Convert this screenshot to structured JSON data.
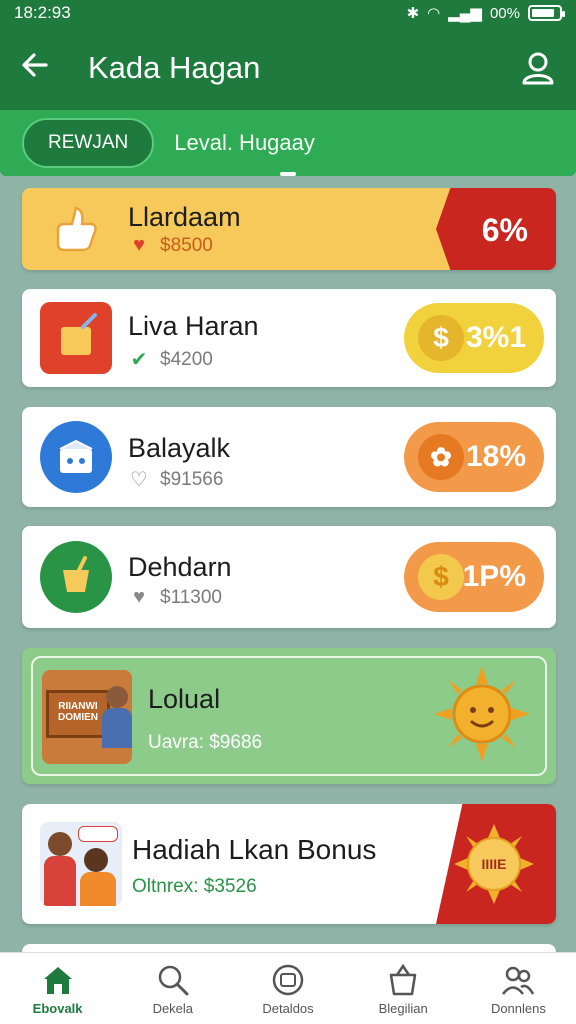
{
  "status_bar": {
    "time": "18:2:93",
    "icons": [
      "bluetooth-icon",
      "wifi-icon",
      "signal-icon"
    ],
    "battery_text": "00%",
    "battery_level": 0.85
  },
  "header": {
    "back_icon": "back-arrow-icon",
    "title": "Kada Hagan",
    "profile_icon": "user-icon"
  },
  "tabs": {
    "active_label": "REWJAN",
    "second_label": "Leval. Hugaay"
  },
  "cards": [
    {
      "name": "Llardaam",
      "sub_icon": "heart-icon",
      "sub_value": "$8500",
      "badge": "6%",
      "icon": "thumbs-up-icon"
    },
    {
      "name": "Liva Haran",
      "sub_icon": "check-icon",
      "sub_value": "$4200",
      "badge": "3%1",
      "icon": "cup-icon"
    },
    {
      "name": "Balayalk",
      "sub_icon": "heart-outline-icon",
      "sub_value": "$91566",
      "badge": "18%",
      "icon": "box-icon"
    },
    {
      "name": "Dehdarn",
      "sub_icon": "heart-icon",
      "sub_value": "$11300",
      "badge": "1P%",
      "icon": "bucket-icon"
    }
  ],
  "featured": {
    "name": "Lolual",
    "sub": "Uavra: $9686",
    "sign_text_line1": "RIIANWI",
    "sign_text_line2": "DOMIEN",
    "icon": "sun-face-icon"
  },
  "bonus": {
    "name": "Hadiah Lkan Bonus",
    "sub": "Oltnrex: $3526",
    "badge_text": "IIIIE",
    "badge_color": "#c8261f"
  },
  "bottom_nav": [
    {
      "label": "Ebovalk",
      "icon": "home-icon",
      "active": true
    },
    {
      "label": "Dekela",
      "icon": "search-icon",
      "active": false
    },
    {
      "label": "Detaldos",
      "icon": "gift-icon",
      "active": false
    },
    {
      "label": "Blegilian",
      "icon": "basket-icon",
      "active": false
    },
    {
      "label": "Donnlens",
      "icon": "people-icon",
      "active": false
    }
  ],
  "colors": {
    "primary": "#1f7a3d",
    "accent_green": "#2faa55",
    "badge_red": "#c8261f",
    "badge_yellow": "#f2c94c",
    "badge_orange": "#f2994a"
  }
}
